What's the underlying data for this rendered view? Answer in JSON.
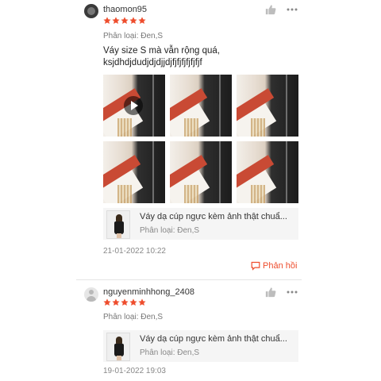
{
  "reviews": [
    {
      "username": "thaomon95",
      "rating": 5,
      "variant": "Phân loại: Đen,S",
      "comment": "Váy size S mà vẫn rộng quá, ksjdhdjdudjdjdjjdjfjfjfjfjfjfjf",
      "photo_count": 6,
      "first_is_video": true,
      "product": {
        "name": "Váy dạ cúp ngực kèm ảnh thật chuẩ...",
        "variant": "Phân loại: Đen,S"
      },
      "date": "21-01-2022 10:22",
      "reply_label": "Phản hồi"
    },
    {
      "username": "nguyenminhhong_2408",
      "rating": 5,
      "variant": "Phân loại: Đen,S",
      "product": {
        "name": "Váy dạ cúp ngực kèm ảnh thật chuẩ...",
        "variant": "Phân loại: Đen,S"
      },
      "date": "19-01-2022 19:03"
    }
  ],
  "icons": {
    "like": "thumbs-up-icon",
    "more": "more-options-icon",
    "star": "star-icon",
    "reply": "chat-bubble-icon",
    "play": "play-icon"
  },
  "colors": {
    "accent": "#ee4d2d",
    "muted_icon": "#bdbdbd"
  }
}
